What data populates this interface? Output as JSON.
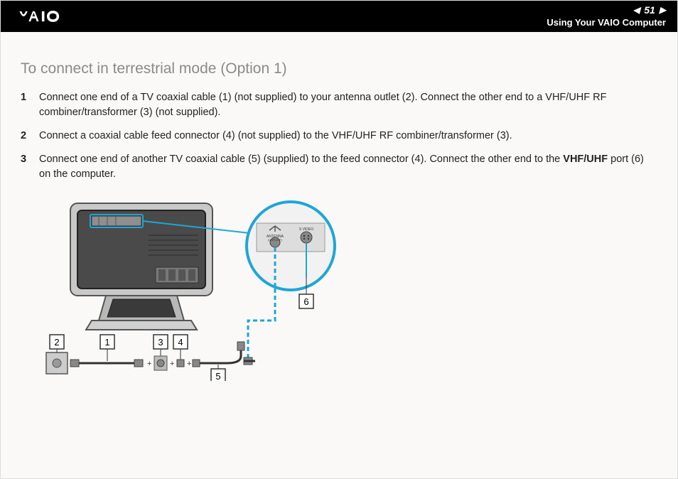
{
  "header": {
    "logo_text": "VAIO",
    "page_number": "51",
    "section": "Using Your VAIO Computer"
  },
  "heading": "To connect in terrestrial mode (Option 1)",
  "steps": [
    {
      "text_a": "Connect one end of a TV coaxial cable (1) (not supplied) to your antenna outlet (2). Connect the other end to a VHF/UHF RF combiner/transformer (3) (not supplied)."
    },
    {
      "text_a": "Connect a coaxial cable feed connector (4) (not supplied) to the VHF/UHF RF combiner/transformer (3)."
    },
    {
      "text_a": "Connect one end of another TV coaxial cable (5) (supplied) to the feed connector (4). Connect the other end to the ",
      "bold": "VHF/UHF",
      "text_b": " port (6) on the computer."
    }
  ],
  "diagram": {
    "callouts": [
      "1",
      "2",
      "3",
      "4",
      "5",
      "6"
    ],
    "port_labels": {
      "antenna": "ANTENNA",
      "sub": "(VHF/UHF)",
      "video": "S VIDEO"
    }
  }
}
